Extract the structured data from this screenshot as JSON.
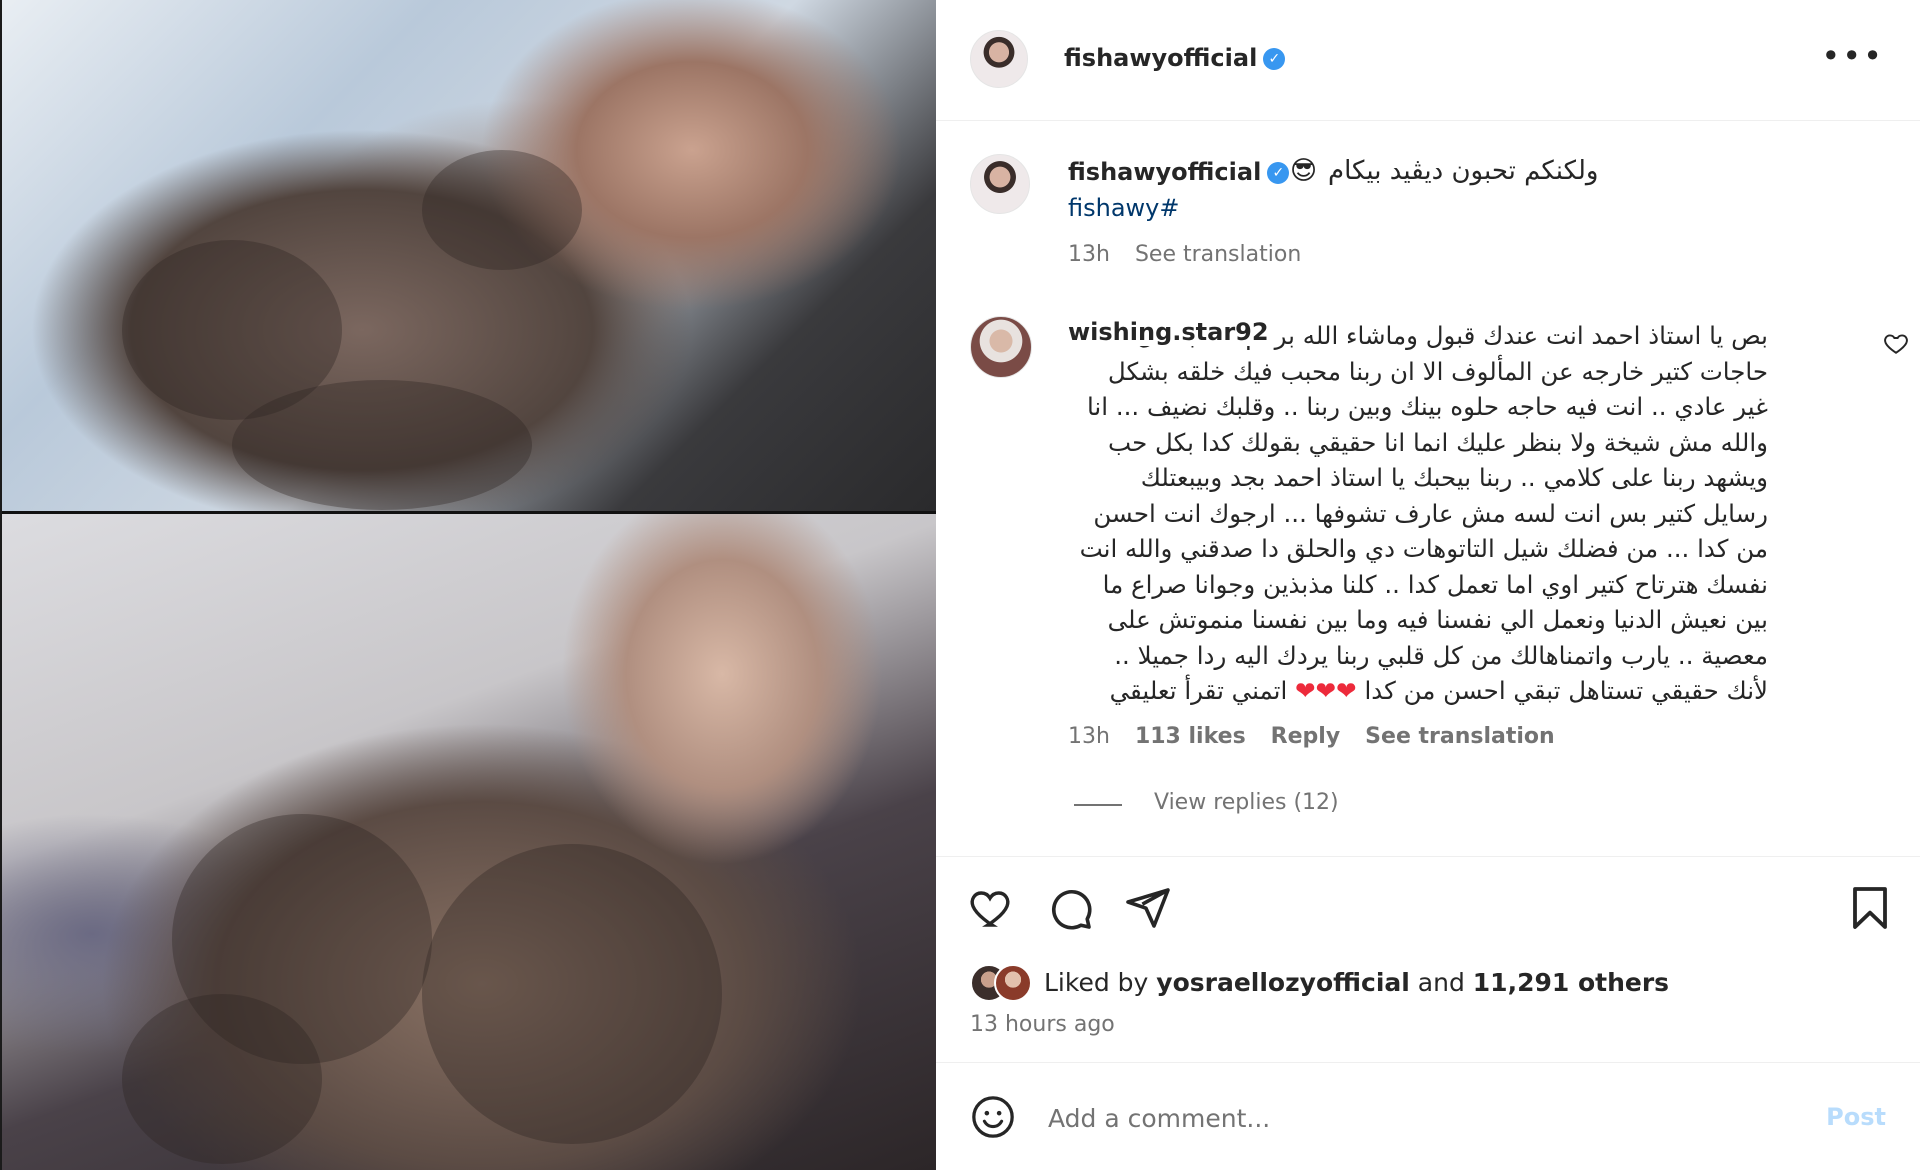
{
  "post": {
    "username": "fishawyofficial",
    "verified_mark": "✓",
    "more_label": "•••",
    "caption": {
      "username": "fishawyofficial",
      "emoji": "😎",
      "text": "ولكنكم تحبون ديڤيد بيكام",
      "hashtag": "fishawy#",
      "time": "13h",
      "see_translation": "See translation"
    },
    "comment": {
      "username": "wishing.star92",
      "text": "بص يا استاذ احمد انت عندك قبول وماشاء الله برغم انك بتعمل حاجات كتير خارجه عن المألوف الا ان ربنا محبب فيك خلقه بشكل غير عادي .. انت فيه حاجه حلوه بينك وبين ربنا .. وقلبك نضيف ... انا والله مش شيخة ولا بنظر عليك انما انا حقيقي بقولك كدا بكل حب ويشهد ربنا على كلامي .. ربنا بيحبك يا استاذ احمد بجد وبيبعتلك رسايل كتير بس انت لسه مش عارف تشوفها ... ارجوك انت احسن من كدا ... من فضلك شيل التاتوهات دي والحلق دا صدقني والله انت نفسك هترتاح كتير اوي اما تعمل كدا .. كلنا مذبذين وجوانا صراع ما بين نعيش الدنيا ونعمل الي نفسنا فيه وما بين نفسنا منموتش على معصية .. يارب واتمناهالك من كل قلبي ربنا يردك اليه ردا جميلا .. لأنك حقيقي تستاهل تبقي احسن من كدا",
      "hearts": "❤❤❤",
      "tail": "اتمني تقرأ تعليقي",
      "time": "13h",
      "likes": "113 likes",
      "reply": "Reply",
      "see_translation": "See translation",
      "view_replies": "View replies (12)"
    },
    "liked_by_prefix": "Liked by ",
    "liked_by_user": "yosraellozyofficial",
    "liked_by_and": " and ",
    "liked_by_others": "11,291 others",
    "time_ago": "13 hours ago",
    "comment_placeholder": "Add a comment...",
    "post_button": "Post",
    "icons": [
      "heart-icon",
      "comment-icon",
      "share-icon",
      "bookmark-icon",
      "emoji-icon",
      "more-icon"
    ]
  }
}
